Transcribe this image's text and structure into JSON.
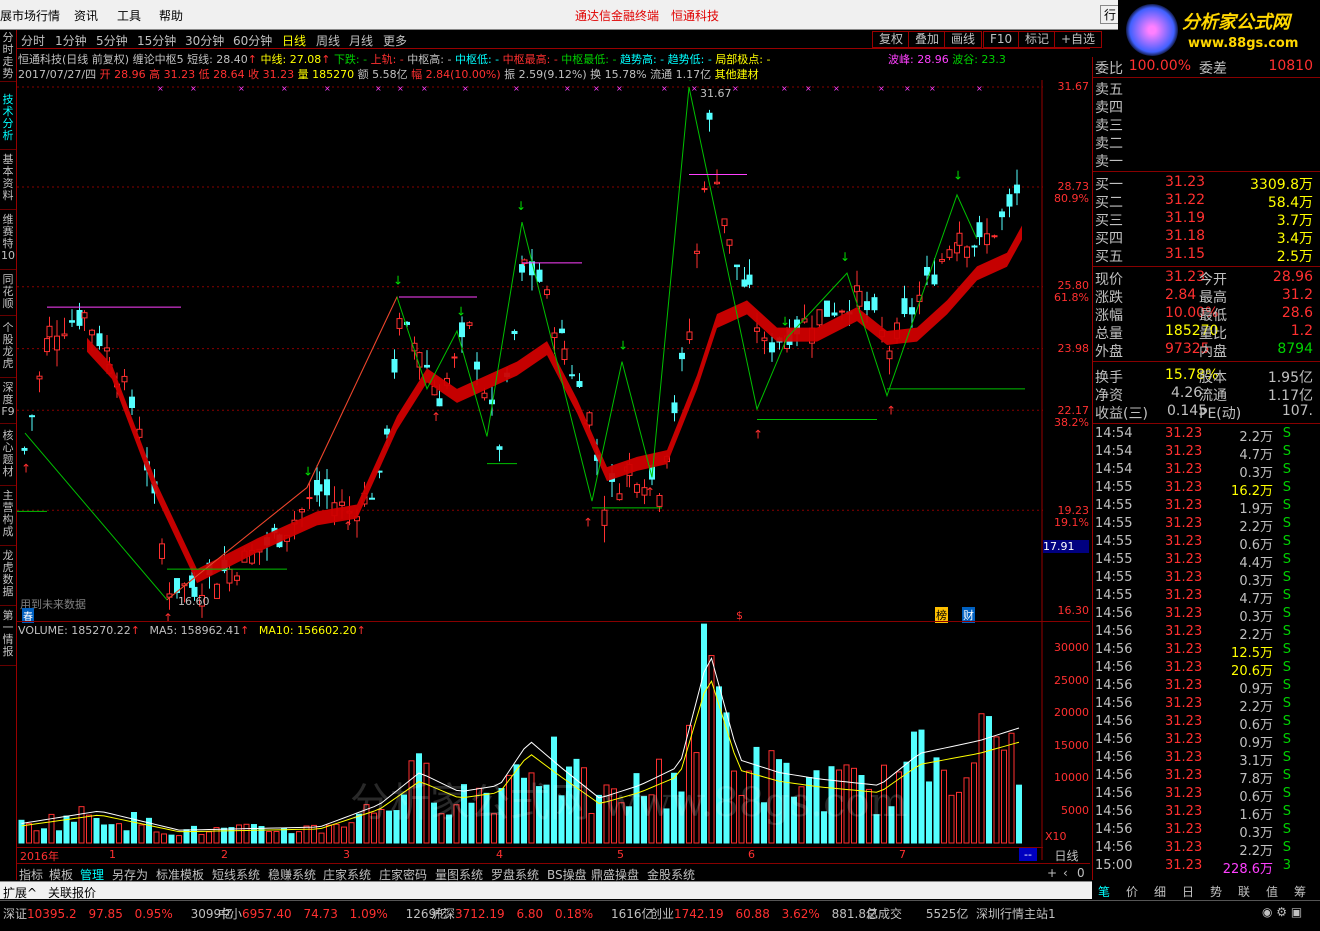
{
  "menu": {
    "items": [
      "展市场行情",
      "资讯",
      "工具",
      "帮助"
    ],
    "right_btn": "行"
  },
  "window_title": {
    "app": "通达信金融终端",
    "stock": "恒通科技"
  },
  "logo": {
    "text": "分析家公式网",
    "url_text": "www.88gs.com"
  },
  "left_tabs": [
    "分时走势",
    "技术分析",
    "基本资料",
    "维赛特10",
    "同花顺",
    "个股龙虎",
    "深度F9",
    "核心题材",
    "主营构成",
    "龙虎数据",
    "第一情报"
  ],
  "periods": [
    "分时",
    "1分钟",
    "5分钟",
    "15分钟",
    "30分钟",
    "60分钟",
    "日线",
    "周线",
    "月线",
    "更多"
  ],
  "active_period": "日线",
  "right_buttons": [
    "复权",
    "叠加",
    "画线",
    "F10",
    "标记",
    "+自选"
  ],
  "info_line1": {
    "name": "恒通科技(日线 前复权)",
    "formula": "缠论中枢5",
    "short": "短线: 28.40",
    "mid": "中线: 27.08",
    "down": "下跌: -",
    "up": "上轨: -",
    "zs_high": "中枢高: -",
    "zs_low": "中枢低: -",
    "zs_max": "中枢最高: -",
    "zs_min": "中枢最低: -",
    "trend_high": "趋势高: -",
    "trend_low": "趋势低: -",
    "local_peak": "局部极点: -",
    "wave_peak": "波峰: 28.96",
    "wave_valley": "波谷: 23.3"
  },
  "info_line2": {
    "date": "2017/07/27/四",
    "open": "开 28.96",
    "high": "高 31.23",
    "low": "低 28.64",
    "close": "收 31.23",
    "vol": "量 185270",
    "amount": "额 5.58亿",
    "change": "幅 2.84(10.00%)",
    "amp": "振 2.59(9.12%)",
    "turnover": "换 15.78%",
    "float": "流通 1.17亿",
    "sector": "其他建材"
  },
  "y_axis": [
    "31.67",
    "28.73",
    "80.9%",
    "25.80",
    "61.8%",
    "23.98",
    "22.17",
    "38.2%",
    "19.23",
    "19.1%",
    "17.91",
    "16.30"
  ],
  "price_labels": {
    "high": "31.67",
    "low": "16.60"
  },
  "future_note": "用到未来数据",
  "markers": {
    "dollar": "$",
    "bang": "榜",
    "cai": "财",
    "chun": "春"
  },
  "volume_line": {
    "volume": "VOLUME: 185270.22",
    "ma5": "MA5: 158962.41",
    "ma10": "MA10: 156602.20"
  },
  "vol_axis": [
    "30000",
    "25000",
    "20000",
    "15000",
    "10000",
    "5000"
  ],
  "vol_unit": "X10",
  "watermark": "分析家公式网 www.88gs.com",
  "x_axis": [
    "2016年",
    "1",
    "2",
    "3",
    "4",
    "5",
    "6",
    "7"
  ],
  "x_period_label": "日线",
  "bottom_tabs": [
    "指标",
    "模板",
    "管理",
    "另存为",
    "标准模板",
    "短线系统",
    "稳赚系统",
    "庄家系统",
    "庄家密码",
    "量图系统",
    "罗盘系统",
    "BS操盘",
    "鼎盛操盘",
    "金股系统"
  ],
  "active_bottom_tab": "管理",
  "ext_bar": [
    "扩展^",
    "关联报价"
  ],
  "quote": {
    "weibi": {
      "label": "委比",
      "value": "100.00%",
      "label2": "委差",
      "value2": "10810"
    },
    "sell": [
      {
        "label": "卖五"
      },
      {
        "label": "卖四"
      },
      {
        "label": "卖三"
      },
      {
        "label": "卖二"
      },
      {
        "label": "卖一"
      }
    ],
    "buy": [
      {
        "label": "买一",
        "price": "31.23",
        "vol": "3309.8万"
      },
      {
        "label": "买二",
        "price": "31.22",
        "vol": "58.4万"
      },
      {
        "label": "买三",
        "price": "31.19",
        "vol": "3.7万"
      },
      {
        "label": "买四",
        "price": "31.18",
        "vol": "3.4万"
      },
      {
        "label": "买五",
        "price": "31.15",
        "vol": "2.5万"
      }
    ],
    "stats": [
      {
        "l1": "现价",
        "v1": "31.23",
        "l2": "今开",
        "v2": "28.96"
      },
      {
        "l1": "涨跌",
        "v1": "2.84",
        "l2": "最高",
        "v2": "31.2"
      },
      {
        "l1": "涨幅",
        "v1": "10.00%",
        "l2": "最低",
        "v2": "28.6"
      },
      {
        "l1": "总量",
        "v1": "185270",
        "l2": "量比",
        "v2": "1.2"
      },
      {
        "l1": "外盘",
        "v1": "97325",
        "l2": "内盘",
        "v2": "8794"
      }
    ],
    "stats2": [
      {
        "l1": "换手",
        "v1": "15.78%",
        "l2": "股本",
        "v2": "1.95亿"
      },
      {
        "l1": "净资",
        "v1": "4.26",
        "l2": "流通",
        "v2": "1.17亿"
      },
      {
        "l1": "收益(三)",
        "v1": "0.145",
        "l2": "PE(动)",
        "v2": "107."
      }
    ]
  },
  "ticks": [
    {
      "t": "14:54",
      "p": "31.23",
      "q": "2.2万",
      "s": "S"
    },
    {
      "t": "14:54",
      "p": "31.23",
      "q": "4.7万",
      "s": "S"
    },
    {
      "t": "14:54",
      "p": "31.23",
      "q": "0.3万",
      "s": "S"
    },
    {
      "t": "14:55",
      "p": "31.23",
      "q": "16.2万",
      "s": "S"
    },
    {
      "t": "14:55",
      "p": "31.23",
      "q": "1.9万",
      "s": "S"
    },
    {
      "t": "14:55",
      "p": "31.23",
      "q": "2.2万",
      "s": "S"
    },
    {
      "t": "14:55",
      "p": "31.23",
      "q": "0.6万",
      "s": "S"
    },
    {
      "t": "14:55",
      "p": "31.23",
      "q": "4.4万",
      "s": "S"
    },
    {
      "t": "14:55",
      "p": "31.23",
      "q": "0.3万",
      "s": "S"
    },
    {
      "t": "14:55",
      "p": "31.23",
      "q": "4.7万",
      "s": "S"
    },
    {
      "t": "14:56",
      "p": "31.23",
      "q": "0.3万",
      "s": "S"
    },
    {
      "t": "14:56",
      "p": "31.23",
      "q": "2.2万",
      "s": "S"
    },
    {
      "t": "14:56",
      "p": "31.23",
      "q": "12.5万",
      "s": "S"
    },
    {
      "t": "14:56",
      "p": "31.23",
      "q": "20.6万",
      "s": "S"
    },
    {
      "t": "14:56",
      "p": "31.23",
      "q": "0.9万",
      "s": "S"
    },
    {
      "t": "14:56",
      "p": "31.23",
      "q": "2.2万",
      "s": "S"
    },
    {
      "t": "14:56",
      "p": "31.23",
      "q": "0.6万",
      "s": "S"
    },
    {
      "t": "14:56",
      "p": "31.23",
      "q": "0.9万",
      "s": "S"
    },
    {
      "t": "14:56",
      "p": "31.23",
      "q": "3.1万",
      "s": "S"
    },
    {
      "t": "14:56",
      "p": "31.23",
      "q": "7.8万",
      "s": "S"
    },
    {
      "t": "14:56",
      "p": "31.23",
      "q": "0.6万",
      "s": "S"
    },
    {
      "t": "14:56",
      "p": "31.23",
      "q": "1.6万",
      "s": "S"
    },
    {
      "t": "14:56",
      "p": "31.23",
      "q": "0.3万",
      "s": "S"
    },
    {
      "t": "14:56",
      "p": "31.23",
      "q": "2.2万",
      "s": "S"
    },
    {
      "t": "15:00",
      "p": "31.23",
      "q": "228.6万",
      "s": "3"
    }
  ],
  "right_tabs": [
    "笔",
    "价",
    "细",
    "日",
    "势",
    "联",
    "值",
    "筹"
  ],
  "status": {
    "sz": {
      "label": "深证",
      "idx": "10395.2",
      "chg": "97.85",
      "pct": "0.95%",
      "amt": "3099亿"
    },
    "zx": {
      "label": "中小",
      "idx": "6957.40",
      "chg": "74.73",
      "pct": "1.09%",
      "amt": "1269亿"
    },
    "hs": {
      "label": "沪深",
      "idx": "3712.19",
      "chg": "6.80",
      "pct": "0.18%",
      "amt": "1616亿"
    },
    "cy": {
      "label": "创业",
      "idx": "1742.19",
      "chg": "60.88",
      "pct": "3.62%",
      "amt": "881.8亿"
    },
    "total": {
      "label": "总成交",
      "amt": "5525亿"
    },
    "station": "深圳行情主站1"
  }
}
